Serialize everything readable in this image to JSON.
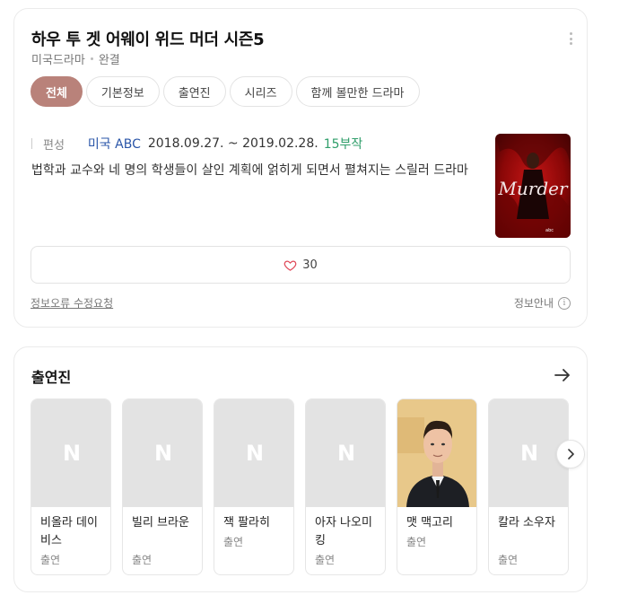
{
  "header": {
    "title": "하우 투 겟 어웨이 위드 머더 시즌5",
    "genre": "미국드라마",
    "status": "완결"
  },
  "tabs": [
    {
      "label": "전체",
      "active": true
    },
    {
      "label": "기본정보",
      "active": false
    },
    {
      "label": "출연진",
      "active": false
    },
    {
      "label": "시리즈",
      "active": false
    },
    {
      "label": "함께 볼만한 드라마",
      "active": false
    }
  ],
  "meta": {
    "label": "편성",
    "network": "미국 ABC",
    "dates": "2018.09.27. ~ 2019.02.28.",
    "episodes": "15부작"
  },
  "description": "법학과 교수와 네 명의 학생들이 살인 계획에 얽히게 되면서 펼쳐지는 스릴러 드라마",
  "poster": {
    "text": "Murder",
    "network": "abc"
  },
  "like": {
    "count": "30"
  },
  "footer": {
    "report_label": "정보오류 수정요청",
    "info_label": "정보안내",
    "info_icon": "i"
  },
  "cast": {
    "title": "출연진",
    "placeholder_letter": "N",
    "members": [
      {
        "name": "비올라 데이비스",
        "role": "출연",
        "has_photo": false
      },
      {
        "name": "빌리 브라운",
        "role": "출연",
        "has_photo": false
      },
      {
        "name": "잭 팔라히",
        "role": "출연",
        "has_photo": false
      },
      {
        "name": "아자 나오미 킹",
        "role": "출연",
        "has_photo": false
      },
      {
        "name": "맷 맥고리",
        "role": "출연",
        "has_photo": true
      },
      {
        "name": "칼라 소우자",
        "role": "출연",
        "has_photo": false
      }
    ]
  },
  "colors": {
    "active_tab": "#b9827a",
    "network": "#2a55a8",
    "episodes": "#2f9e6a",
    "heart": "#e04a5a"
  }
}
